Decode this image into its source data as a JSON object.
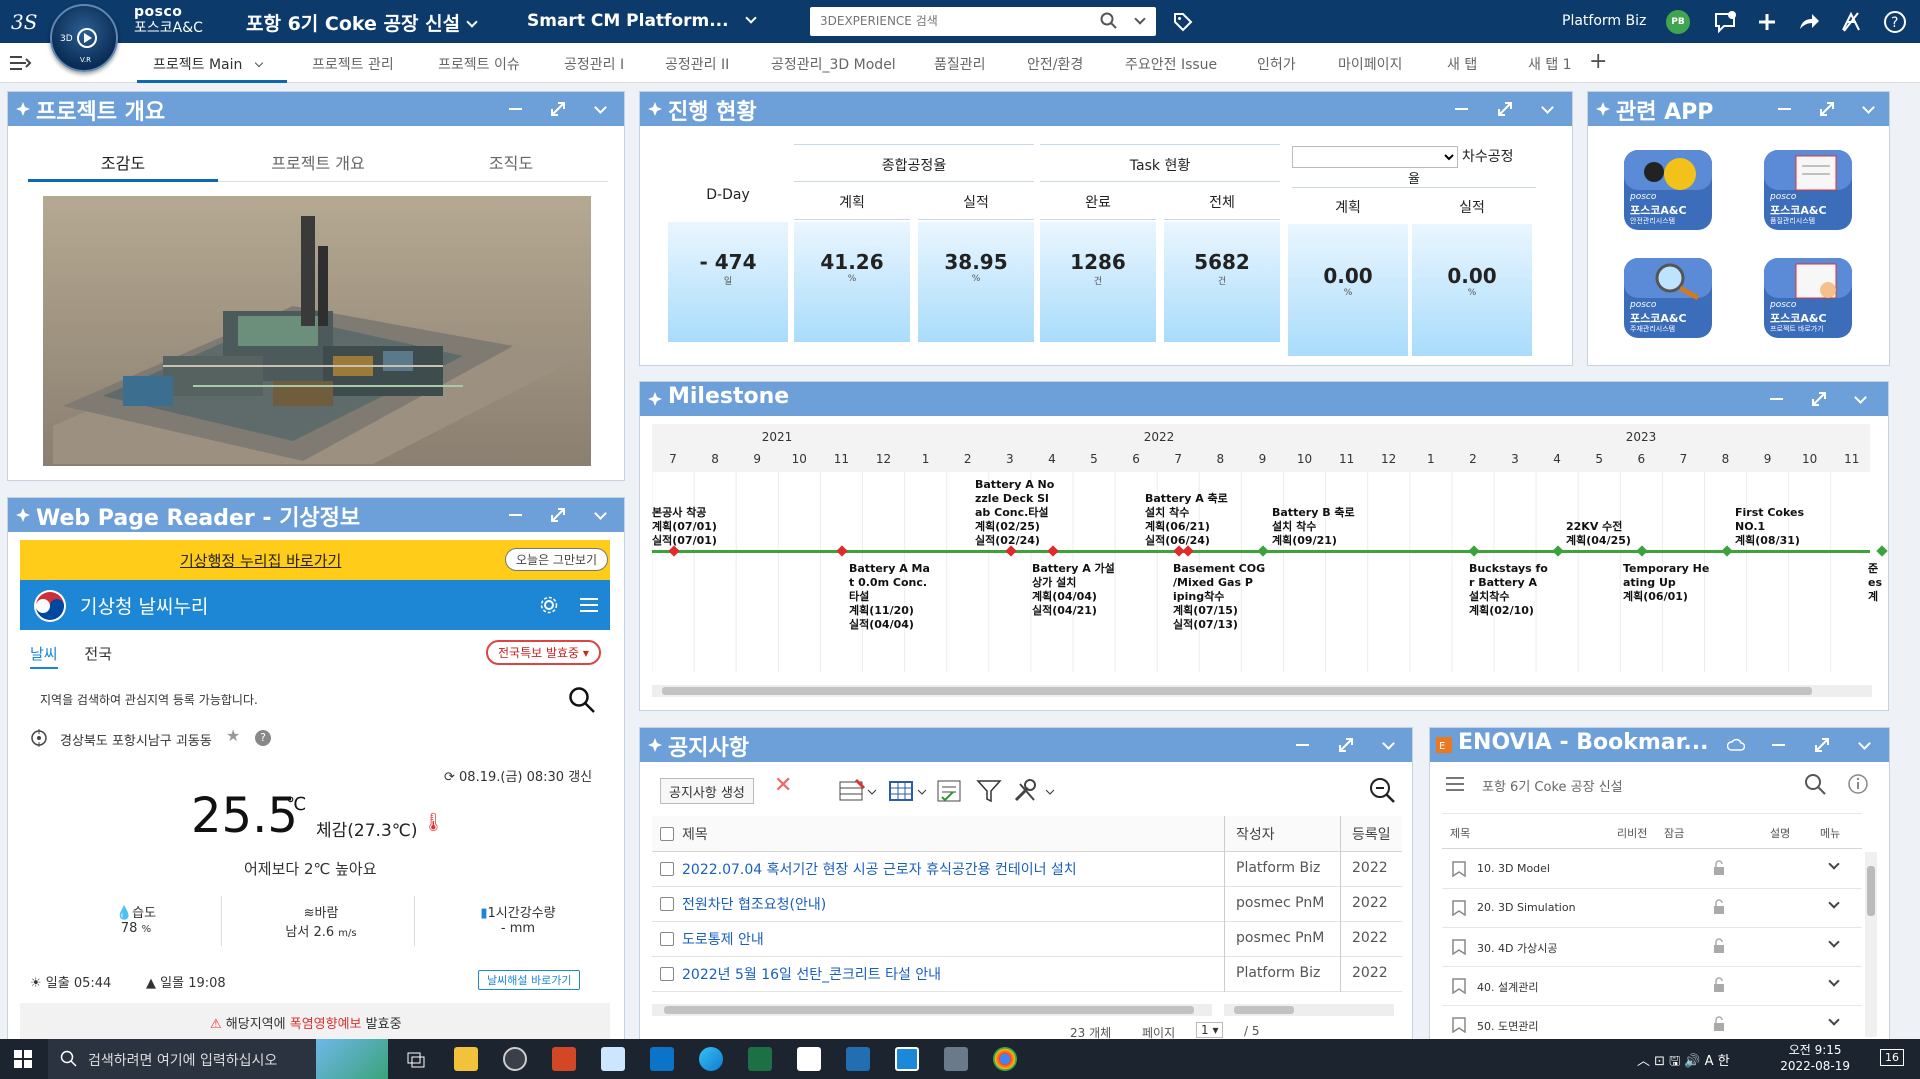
{
  "header": {
    "brand_line1": "posco",
    "brand_line2": "포스코A&C",
    "compass_3d": "3D",
    "compass_vr": "V.R",
    "project_title": "포항 6기 Coke 공장 신설",
    "platform_title": "Smart CM Platform...",
    "search_placeholder": "3DEXPERIENCE 검색",
    "user_name": "Platform Biz",
    "user_initials": "PB"
  },
  "tabs": [
    {
      "label": "프로젝트 Main"
    },
    {
      "label": "프로젝트 관리"
    },
    {
      "label": "프로젝트 이슈"
    },
    {
      "label": "공정관리 I"
    },
    {
      "label": "공정관리 II"
    },
    {
      "label": "공정관리_3D Model"
    },
    {
      "label": "품질관리"
    },
    {
      "label": "안전/환경"
    },
    {
      "label": "주요안전 Issue"
    },
    {
      "label": "인허가"
    },
    {
      "label": "마이페이지"
    },
    {
      "label": "새 탭"
    },
    {
      "label": "새 탭 1"
    }
  ],
  "overview": {
    "title": "프로젝트 개요",
    "subtabs": [
      "조감도",
      "프로젝트 개요",
      "조직도"
    ]
  },
  "progress": {
    "title": "진행 현황",
    "dday_label": "D-Day",
    "dday_value": "- 474",
    "dday_unit": "일",
    "overall_label": "종합공정율",
    "plan_label": "계획",
    "actual_label": "실적",
    "plan_value": "41.26",
    "actual_value": "38.95",
    "pct_unit": "%",
    "task_label": "Task 현황",
    "done_label": "완료",
    "total_label": "전체",
    "done_value": "1286",
    "total_value": "5682",
    "count_unit": "건",
    "phase_label": "차수공정",
    "rate_label": "율",
    "phase_plan_label": "계획",
    "phase_actual_label": "실적",
    "phase_plan_value": "0.00",
    "phase_actual_value": "0.00"
  },
  "apps": {
    "title": "관련 APP",
    "items": [
      {
        "brand": "posco",
        "name": "포스코A&C",
        "sub": "안전관리시스템"
      },
      {
        "brand": "posco",
        "name": "포스코A&C",
        "sub": "품질관리시스템"
      },
      {
        "brand": "posco",
        "name": "포스코A&C",
        "sub": "주재관리시스템"
      },
      {
        "brand": "posco",
        "name": "포스코A&C",
        "sub": "프로젝트 바로가기"
      }
    ]
  },
  "weather": {
    "title": "Web Page Reader - 기상정보",
    "link": "기상행정 누리집 바로가기",
    "hide_today": "오늘은 그만보기",
    "kma_title": "기상청 날씨누리",
    "tab_weather": "날씨",
    "tab_national": "전국",
    "alert_btn": "전국특보 발효중",
    "hint": "지역을 검색하여 관심지역 등록 가능합니다.",
    "location": "경상북도 포항시남구 괴동동",
    "updated": "08.19.(금) 08:30 갱신",
    "temp": "25.5",
    "temp_unit": "℃",
    "feels": "체감(27.3℃)",
    "compare": "어제보다 2℃ 높아요",
    "humidity_label": "습도",
    "humidity_value": "78",
    "humidity_unit": "%",
    "wind_label": "바람",
    "wind_value": "남서 2.6",
    "wind_unit": "m/s",
    "rain_label": "1시간강수량",
    "rain_value": "- mm",
    "sunrise_label": "일출",
    "sunrise_value": "05:44",
    "sunset_label": "일몰",
    "sunset_value": "19:08",
    "explain_btn": "날씨해설 바로가기",
    "warning_pre": "해당지역에",
    "warning_em": "폭염영향예보",
    "warning_post": "발효중"
  },
  "milestone": {
    "title": "Milestone",
    "years": [
      "2021",
      "2022",
      "2023"
    ],
    "months": [
      "7",
      "8",
      "9",
      "10",
      "11",
      "12",
      "1",
      "2",
      "3",
      "4",
      "5",
      "6",
      "7",
      "8",
      "9",
      "10",
      "11",
      "12",
      "1",
      "2",
      "3",
      "4",
      "5",
      "6",
      "7",
      "8",
      "9",
      "10",
      "11"
    ],
    "events_top": [
      {
        "text": "본공사 착공\n계획(07/01)\n실적(07/01)"
      },
      {
        "text": "Battery A No\nzzle Deck Sl\nab Conc.타설\n계획(02/25)\n실적(02/24)"
      },
      {
        "text": "Battery A 축로\n설치 착수\n계획(06/21)\n실적(06/24)"
      },
      {
        "text": "Battery B 축로\n설치 착수\n계획(09/21)"
      },
      {
        "text": "22KV 수전\n계획(04/25)"
      },
      {
        "text": "First Cokes\nNO.1\n계획(08/31)"
      }
    ],
    "events_bottom": [
      {
        "text": "Battery A Ma\nt 0.0m Conc.\n타설\n계획(11/20)\n실적(04/04)"
      },
      {
        "text": "Battery A 가설\n상가 설치\n계획(04/04)\n실적(04/21)"
      },
      {
        "text": "Basement COG\n/Mixed Gas P\niping착수\n계획(07/15)\n실적(07/13)"
      },
      {
        "text": "Buckstays fo\nr Battery A\n설치착수\n계획(02/10)"
      },
      {
        "text": "Temporary He\nating Up\n계획(06/01)"
      },
      {
        "text": "준\nes\n계"
      }
    ]
  },
  "notice": {
    "title": "공지사항",
    "create_btn": "공지사항 생성",
    "col_title": "제목",
    "col_author": "작성자",
    "col_date": "등록일",
    "rows": [
      {
        "title": "2022.07.04 혹서기간 현장 시공 근로자 휴식공간용 컨테이너 설치",
        "author": "Platform Biz",
        "date": "2022"
      },
      {
        "title": "전원차단 협조요청(안내)",
        "author": "posmec PnM",
        "date": "2022"
      },
      {
        "title": "도로통제 안내",
        "author": "posmec PnM",
        "date": "2022"
      },
      {
        "title": "2022년 5월 16일 선탄_콘크리트 타설 안내",
        "author": "Platform Biz",
        "date": "2022"
      }
    ],
    "count": "23 개체",
    "page_label": "페이지",
    "page_value": "1",
    "page_total": "/ 5"
  },
  "enovia": {
    "title": "ENOVIA - Bookmar...",
    "path": "포항 6기 Coke 공장 신설",
    "col_title": "제목",
    "col_rev": "리비전",
    "col_lock": "잠금",
    "col_desc": "설명",
    "col_menu": "메뉴",
    "rows": [
      {
        "name": "10. 3D Model"
      },
      {
        "name": "20. 3D Simulation"
      },
      {
        "name": "30. 4D 가상시공"
      },
      {
        "name": "40. 설계관리"
      },
      {
        "name": "50. 도면관리"
      }
    ]
  },
  "taskbar": {
    "search_placeholder": "검색하려면 여기에 입력하십시오",
    "time": "오전 9:15",
    "date": "2022-08-19",
    "badge": "16"
  },
  "colors": {
    "header_bg": "#0c3a6b",
    "panel_head": "#6d9fd9",
    "accent": "#0c68b3",
    "milestone_line": "#3aa33a",
    "milestone_red": "#e02b2b"
  }
}
